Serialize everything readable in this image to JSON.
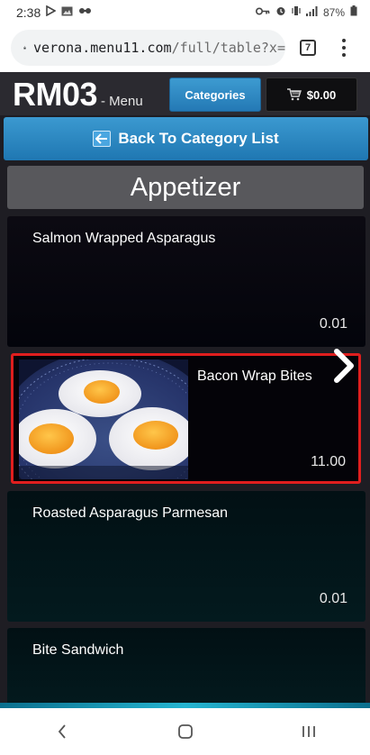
{
  "status": {
    "time": "2:38",
    "battery": "87%",
    "left_icons": [
      "play-icon",
      "gallery-icon",
      "link-icon"
    ],
    "right_icons": [
      "key-icon",
      "alarm-icon",
      "vibrate-icon",
      "signal-icon",
      "battery-icon"
    ]
  },
  "browser": {
    "url_host": "verona.menu11.com",
    "url_path": "/full/table?x=",
    "tab_count": "7"
  },
  "header": {
    "brand": "RM03",
    "brand_suffix": "- Menu",
    "categories_label": "Categories",
    "cart_total": "$0.00"
  },
  "back_label": "Back To Category List",
  "section_title": "Appetizer",
  "items": [
    {
      "name": "Salmon Wrapped Asparagus",
      "price": "0.01"
    },
    {
      "name": "Bacon Wrap Bites",
      "price": "11.00",
      "selected": true
    },
    {
      "name": "Roasted Asparagus Parmesan",
      "price": "0.01"
    },
    {
      "name": "Bite Sandwich",
      "price": ""
    }
  ],
  "colors": {
    "accent_blue": "#2479b5",
    "selection_red": "#e01e1e",
    "app_bg": "#1e1d23"
  }
}
